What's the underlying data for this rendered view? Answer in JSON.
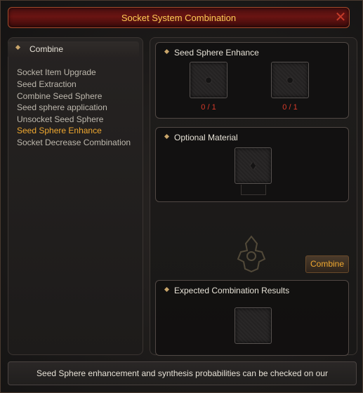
{
  "window": {
    "title": "Socket System Combination",
    "close_icon": "close-icon"
  },
  "sidebar": {
    "header": "Combine",
    "items": [
      {
        "label": "Socket Item Upgrade",
        "active": false
      },
      {
        "label": "Seed Extraction",
        "active": false
      },
      {
        "label": "Combine Seed Sphere",
        "active": false
      },
      {
        "label": "Seed sphere application",
        "active": false
      },
      {
        "label": "Unsocket Seed Sphere",
        "active": false
      },
      {
        "label": "Seed Sphere Enhance",
        "active": true
      },
      {
        "label": "Socket Decrease Combination",
        "active": false
      }
    ]
  },
  "enhance": {
    "title": "Seed Sphere Enhance",
    "slot1_count": "0 / 1",
    "slot2_count": "0 / 1"
  },
  "optional": {
    "title": "Optional Material"
  },
  "combine_button": "Combine",
  "results": {
    "title": "Expected Combination Results"
  },
  "footer": {
    "text": "Seed Sphere enhancement and synthesis probabilities can be checked on our"
  },
  "colors": {
    "accent": "#f0a830",
    "title_text": "#ffcc55",
    "count_red": "#d83a2a",
    "titlebar_bg": "#6a1412"
  }
}
